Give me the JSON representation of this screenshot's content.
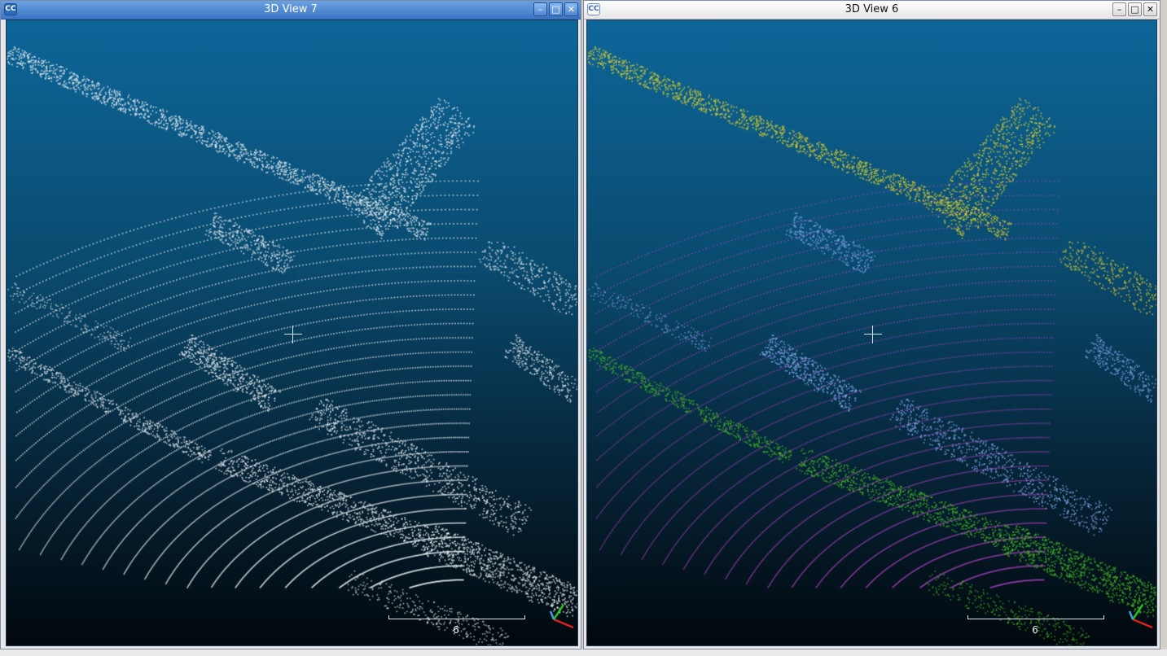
{
  "windows": [
    {
      "id": "left",
      "title": "3D View 7",
      "controls": {
        "minimize": "–",
        "maximize": "□",
        "close": "✕"
      },
      "app_icon": "cloudcompare-icon",
      "scale_label": "6",
      "color_mode": "white"
    },
    {
      "id": "right",
      "title": "3D View 6",
      "controls": {
        "minimize": "–",
        "maximize": "□",
        "close": "✕"
      },
      "app_icon": "cloudcompare-icon",
      "scale_label": "6",
      "color_mode": "segmented"
    }
  ],
  "colors": {
    "background_top": "#0d6699",
    "background_bottom": "#02080d",
    "point_white": "#e6ecf0",
    "segment_yellow": "#d8cc2a",
    "segment_magenta": "#c24ad6",
    "segment_blue": "#7fa8ec",
    "segment_green": "#48b824",
    "axis_x": "#e02020",
    "axis_y": "#22c022",
    "axis_z": "#3aa0e8"
  }
}
